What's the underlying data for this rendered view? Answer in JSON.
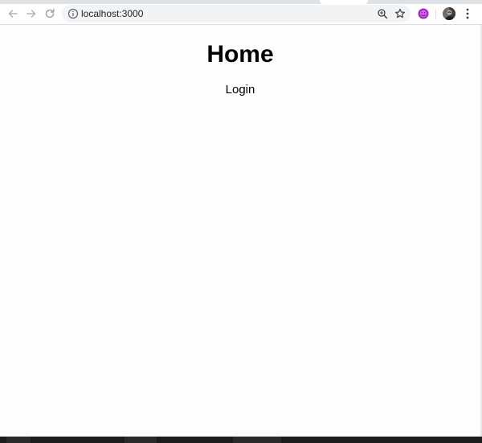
{
  "browser": {
    "url": "localhost:3000",
    "icons": {
      "back": "arrow-left-icon",
      "forward": "arrow-right-icon",
      "reload": "reload-icon",
      "site_info": "info-icon",
      "zoom": "zoom-icon",
      "bookmark": "star-icon",
      "extension": "extension-icon",
      "profile": "avatar",
      "menu": "kebab-menu-icon"
    },
    "colors": {
      "extension_accent": "#9c27b0"
    }
  },
  "page": {
    "title": "Home",
    "login_label": "Login"
  }
}
